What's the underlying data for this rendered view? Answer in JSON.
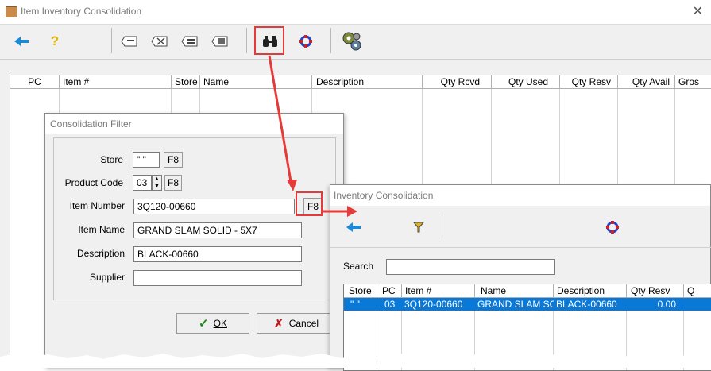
{
  "main": {
    "title": "Item Inventory Consolidation",
    "columns": [
      "PC",
      "Item #",
      "Store",
      "Name",
      "Description",
      "Qty Rcvd",
      "Qty Used",
      "Qty Resv",
      "Qty Avail",
      "Gros"
    ]
  },
  "filter": {
    "title": "Consolidation Filter",
    "store_label": "Store",
    "store_value": "\" \"",
    "product_code_label": "Product Code",
    "product_code_value": "03",
    "item_number_label": "Item Number",
    "item_number_value": "3Q120-00660",
    "item_name_label": "Item Name",
    "item_name_value": "GRAND SLAM SOLID - 5X7",
    "description_label": "Description",
    "description_value": "BLACK-00660",
    "supplier_label": "Supplier",
    "supplier_value": "",
    "f8": "F8",
    "ok_label": "OK",
    "cancel_label": "Cancel"
  },
  "consolidation": {
    "title": "Inventory Consolidation",
    "search_label": "Search",
    "search_value": "",
    "columns": [
      "Store",
      "PC",
      "Item #",
      "Name",
      "Description",
      "Qty Resv",
      "Q"
    ],
    "row": [
      "\" \"",
      "03",
      "3Q120-00660",
      "GRAND SLAM SO",
      "BLACK-00660",
      "0.00"
    ]
  },
  "colors": {
    "accent_blue": "#1b8ad6",
    "selection_blue": "#0a78d7",
    "highlight_red": "#e53a3a"
  },
  "icons": [
    "app-icon",
    "back-arrow-icon",
    "help-icon",
    "tag-icon",
    "tag-delete-icon",
    "tag-list-icon",
    "tag-print-icon",
    "binoculars-icon",
    "refresh-icon",
    "gears-icon",
    "filter-icon"
  ]
}
